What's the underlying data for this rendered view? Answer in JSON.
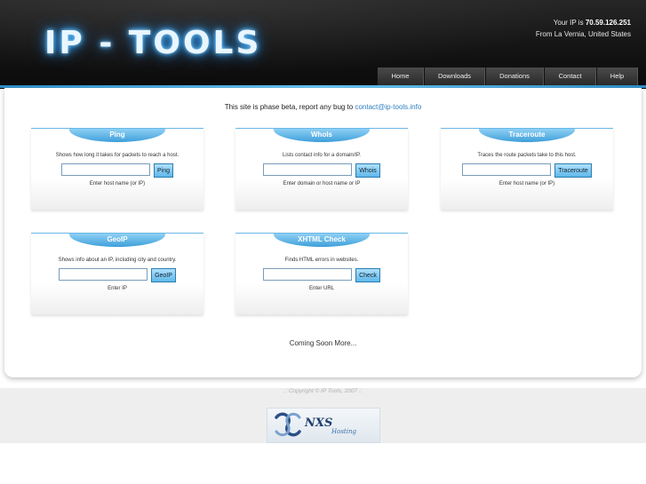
{
  "header": {
    "logo_text": "IP - TOOLS",
    "ip_label": "Your IP is",
    "ip_value": "70.59.126.251",
    "location": "From La Vernia, United States"
  },
  "nav": {
    "items": [
      {
        "label": "Home"
      },
      {
        "label": "Downloads"
      },
      {
        "label": "Donations"
      },
      {
        "label": "Contact"
      },
      {
        "label": "Help"
      }
    ]
  },
  "notice": {
    "text": "This site is phase beta, report any bug to",
    "email": "contact@ip-tools.info"
  },
  "tools": [
    {
      "title": "Ping",
      "description": "Shows how long it takes for packets to reach a host.",
      "input_value": "",
      "button_label": "Ping",
      "help": "Enter host name (or IP)"
    },
    {
      "title": "WhoIs",
      "description": "Lists contact info for a domain/IP.",
      "input_value": "",
      "button_label": "Whois",
      "help": "Enter domain or host name or IP"
    },
    {
      "title": "Traceroute",
      "description": "Traces the route packets take to this host.",
      "input_value": "",
      "button_label": "Traceroute",
      "help": "Enter host name (or IP)"
    },
    {
      "title": "GeoIP",
      "description": "Shows info about an IP, including city and country.",
      "input_value": "",
      "button_label": "GeoIP",
      "help": "Enter IP"
    },
    {
      "title": "XHTML Check",
      "description": "Finds HTML errors in websites.",
      "input_value": "",
      "button_label": "Check",
      "help": "Enter URL"
    }
  ],
  "coming_soon": "Coming Soon More...",
  "footer": {
    "copyright": ".: Copyright © IP Tools, 2007 :.",
    "sponsor_name": "NXS",
    "sponsor_sub": "Hosting"
  },
  "colors": {
    "accent": "#3e9fd9",
    "header_bg": "#141414",
    "link": "#2f7fc1"
  }
}
